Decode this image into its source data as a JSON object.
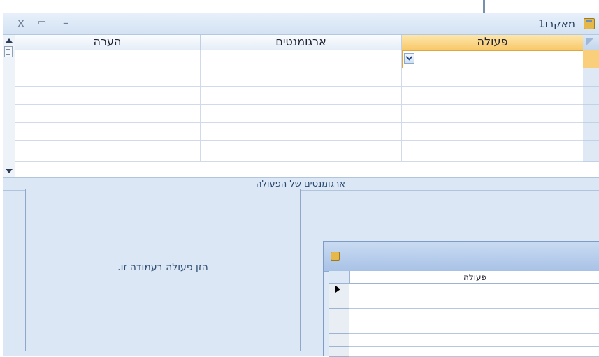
{
  "window": {
    "title": "מאקרו1",
    "close_label": "x",
    "restore_label": "▭",
    "minimize_label": "–"
  },
  "grid": {
    "columns": [
      "פעולה",
      "ארגומנטים",
      "הערה"
    ],
    "row_count": 6
  },
  "arguments_section": {
    "title": "ארגומנטים של הפעולה",
    "hint_text": "הזן פעולה בעמודה זו."
  },
  "popup": {
    "column_header": "פעולה"
  },
  "colors": {
    "selected_header": "#f8c96a",
    "window_bg": "#dbe7f4"
  }
}
